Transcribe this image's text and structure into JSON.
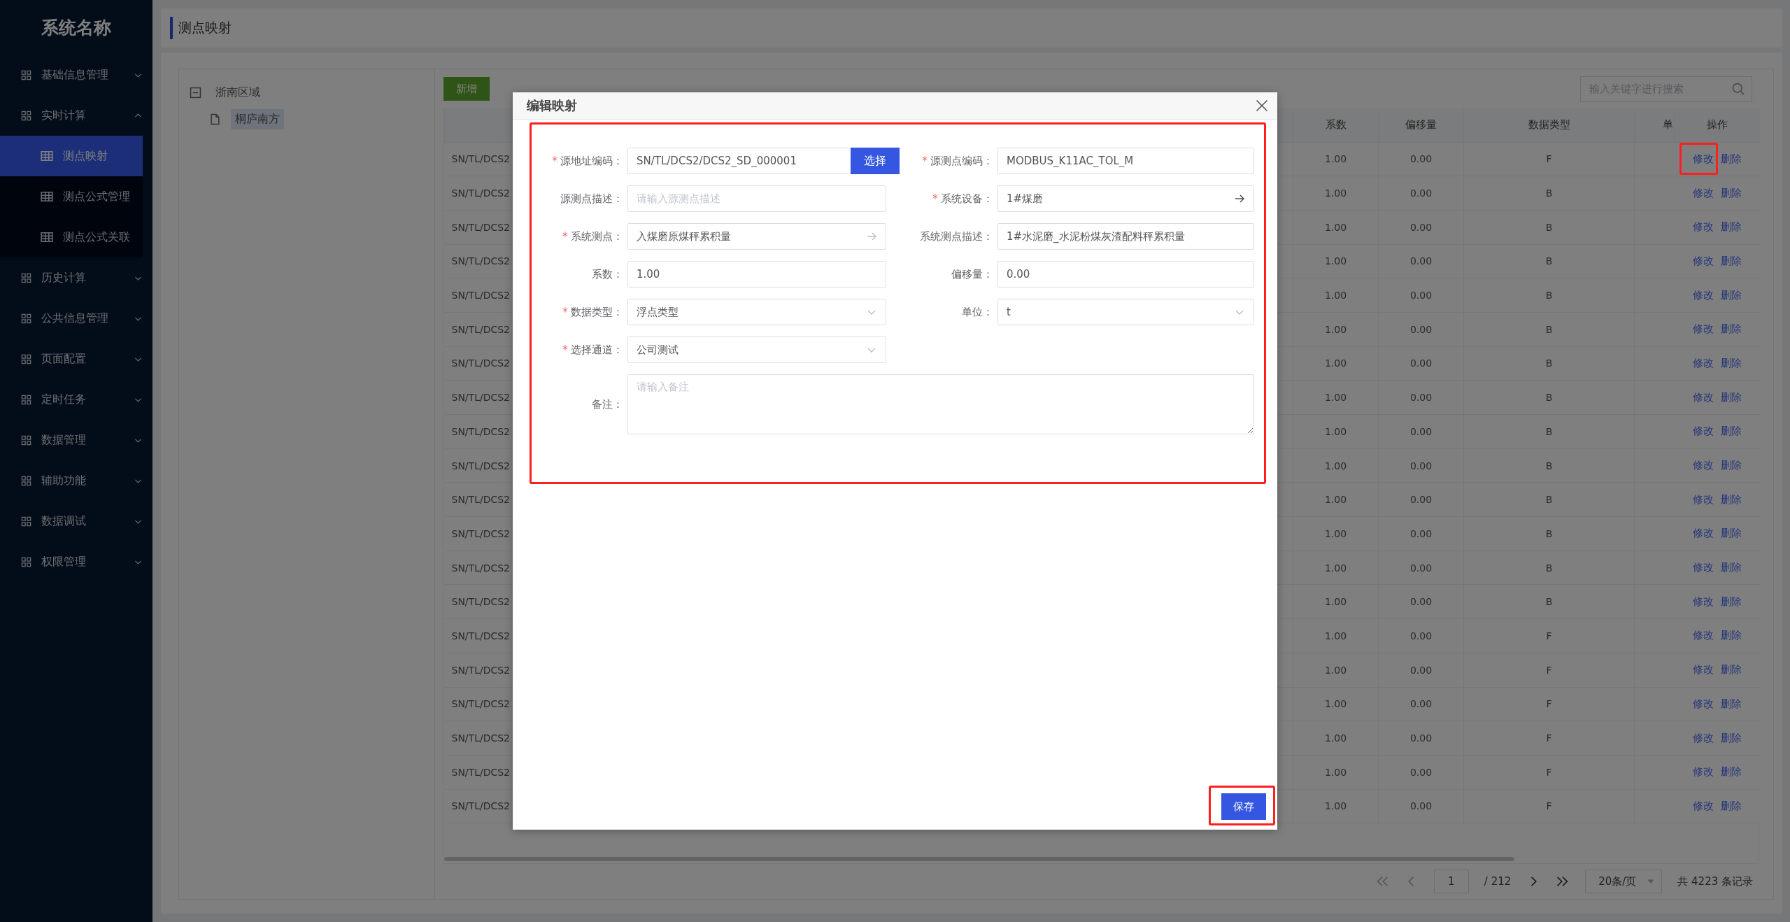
{
  "sidebar": {
    "title": "系统名称",
    "items": [
      {
        "label": "基础信息管理",
        "expanded": false
      },
      {
        "label": "实时计算",
        "expanded": true,
        "children": [
          {
            "label": "测点映射",
            "selected": true
          },
          {
            "label": "测点公式管理",
            "selected": false
          },
          {
            "label": "测点公式关联",
            "selected": false
          }
        ]
      },
      {
        "label": "历史计算",
        "expanded": false
      },
      {
        "label": "公共信息管理",
        "expanded": false
      },
      {
        "label": "页面配置",
        "expanded": false
      },
      {
        "label": "定时任务",
        "expanded": false
      },
      {
        "label": "数据管理",
        "expanded": false
      },
      {
        "label": "辅助功能",
        "expanded": false
      },
      {
        "label": "数据调试",
        "expanded": false
      },
      {
        "label": "权限管理",
        "expanded": false
      }
    ]
  },
  "page_title": "测点映射",
  "tree": [
    {
      "label": "浙南区域",
      "expanded": true,
      "selected": false,
      "children": [
        {
          "label": "桐庐南方",
          "selected": true
        }
      ]
    }
  ],
  "toolbar": {
    "add_button": "新增",
    "search": {
      "placeholder": "输入关键字进行搜索"
    }
  },
  "table": {
    "columns": [
      {
        "label": "系数"
      },
      {
        "label": "偏移量"
      },
      {
        "label": "数据类型"
      },
      {
        "label": "单"
      },
      {
        "label": "操作"
      }
    ],
    "rows": [
      {
        "column_1": "SN/TL/DCS2",
        "cells": [
          "1.00",
          "0.00",
          "F"
        ],
        "actions": [
          "修改",
          "删除"
        ],
        "highlighted": true
      },
      {
        "column_1": "SN/TL/DCS2",
        "cells": [
          "1.00",
          "0.00",
          "B"
        ],
        "actions": [
          "修改",
          "删除"
        ],
        "highlighted": false
      },
      {
        "column_1": "SN/TL/DCS2",
        "cells": [
          "1.00",
          "0.00",
          "B"
        ],
        "actions": [
          "修改",
          "删除"
        ],
        "highlighted": false
      },
      {
        "column_1": "SN/TL/DCS2",
        "cells": [
          "1.00",
          "0.00",
          "B"
        ],
        "actions": [
          "修改",
          "删除"
        ],
        "highlighted": false
      },
      {
        "column_1": "SN/TL/DCS2",
        "cells": [
          "1.00",
          "0.00",
          "B"
        ],
        "actions": [
          "修改",
          "删除"
        ],
        "highlighted": false
      },
      {
        "column_1": "SN/TL/DCS2",
        "cells": [
          "1.00",
          "0.00",
          "B"
        ],
        "actions": [
          "修改",
          "删除"
        ],
        "highlighted": false
      },
      {
        "column_1": "SN/TL/DCS2",
        "cells": [
          "1.00",
          "0.00",
          "B"
        ],
        "actions": [
          "修改",
          "删除"
        ],
        "highlighted": false
      },
      {
        "column_1": "SN/TL/DCS2",
        "cells": [
          "1.00",
          "0.00",
          "B"
        ],
        "actions": [
          "修改",
          "删除"
        ],
        "highlighted": false
      },
      {
        "column_1": "SN/TL/DCS2",
        "cells": [
          "1.00",
          "0.00",
          "B"
        ],
        "actions": [
          "修改",
          "删除"
        ],
        "highlighted": false
      },
      {
        "column_1": "SN/TL/DCS2",
        "cells": [
          "1.00",
          "0.00",
          "B"
        ],
        "actions": [
          "修改",
          "删除"
        ],
        "highlighted": false
      },
      {
        "column_1": "SN/TL/DCS2",
        "cells": [
          "1.00",
          "0.00",
          "B"
        ],
        "actions": [
          "修改",
          "删除"
        ],
        "highlighted": false
      },
      {
        "column_1": "SN/TL/DCS2",
        "cells": [
          "1.00",
          "0.00",
          "B"
        ],
        "actions": [
          "修改",
          "删除"
        ],
        "highlighted": false
      },
      {
        "column_1": "SN/TL/DCS2",
        "cells": [
          "1.00",
          "0.00",
          "B"
        ],
        "actions": [
          "修改",
          "删除"
        ],
        "highlighted": false
      },
      {
        "column_1": "SN/TL/DCS2",
        "cells": [
          "1.00",
          "0.00",
          "B"
        ],
        "actions": [
          "修改",
          "删除"
        ],
        "highlighted": false
      },
      {
        "column_1": "SN/TL/DCS2",
        "cells": [
          "1.00",
          "0.00",
          "F"
        ],
        "actions": [
          "修改",
          "删除"
        ],
        "highlighted": false
      },
      {
        "column_1": "SN/TL/DCS2",
        "cells": [
          "1.00",
          "0.00",
          "F"
        ],
        "actions": [
          "修改",
          "删除"
        ],
        "highlighted": false
      },
      {
        "column_1": "SN/TL/DCS2",
        "cells": [
          "1.00",
          "0.00",
          "F"
        ],
        "actions": [
          "修改",
          "删除"
        ],
        "highlighted": false
      },
      {
        "column_1": "SN/TL/DCS2",
        "cells": [
          "1.00",
          "0.00",
          "F"
        ],
        "actions": [
          "修改",
          "删除"
        ],
        "highlighted": false
      },
      {
        "column_1": "SN/TL/DCS2",
        "cells": [
          "1.00",
          "0.00",
          "F"
        ],
        "actions": [
          "修改",
          "删除"
        ],
        "highlighted": false
      },
      {
        "column_1": "SN/TL/DCS2",
        "cells": [
          "1.00",
          "0.00",
          "F"
        ],
        "actions": [
          "修改",
          "删除"
        ],
        "highlighted": false
      }
    ]
  },
  "pagination": {
    "first_disabled": true,
    "page": "1",
    "total_pages": "/ 212",
    "last_disabled": false,
    "page_size": "20条/页",
    "total": "共 4223 条记录"
  },
  "dialog": {
    "title": "编辑映射",
    "highlighted": true,
    "fields": [
      {
        "kind": "picker-button",
        "label": "源地址编码：",
        "required": true,
        "value": "SN/TL/DCS2/DCS2_SD_000001",
        "button": "选择"
      },
      {
        "kind": "text",
        "label": "源测点编码：",
        "required": true,
        "value": "MODBUS_K11AC_TOL_M"
      },
      {
        "kind": "text",
        "label": "源测点描述：",
        "required": false,
        "placeholder": "请输入源测点描述"
      },
      {
        "kind": "link",
        "label": "系统设备：",
        "required": true,
        "value": "1#煤磨"
      },
      {
        "kind": "link",
        "label": "系统测点：",
        "required": true,
        "value": "入煤磨原煤秤累积量"
      },
      {
        "kind": "text",
        "label": "系统测点描述：",
        "required": false,
        "value": "1#水泥磨_水泥粉煤灰渣配料秤累积量"
      },
      {
        "kind": "text",
        "label": "系数：",
        "required": false,
        "value": "1.00"
      },
      {
        "kind": "text",
        "label": "偏移量：",
        "required": false,
        "value": "0.00"
      },
      {
        "kind": "select",
        "label": "数据类型：",
        "required": true,
        "value": "浮点类型"
      },
      {
        "kind": "select",
        "label": "单位：",
        "required": false,
        "value": "t"
      },
      {
        "kind": "select",
        "label": "选择通道：",
        "required": true,
        "value": "公司测试"
      },
      {
        "kind": "textarea",
        "label": "备注：",
        "required": false,
        "placeholder": "请输入备注"
      }
    ],
    "save": {
      "label": "保存",
      "highlighted": true
    }
  }
}
